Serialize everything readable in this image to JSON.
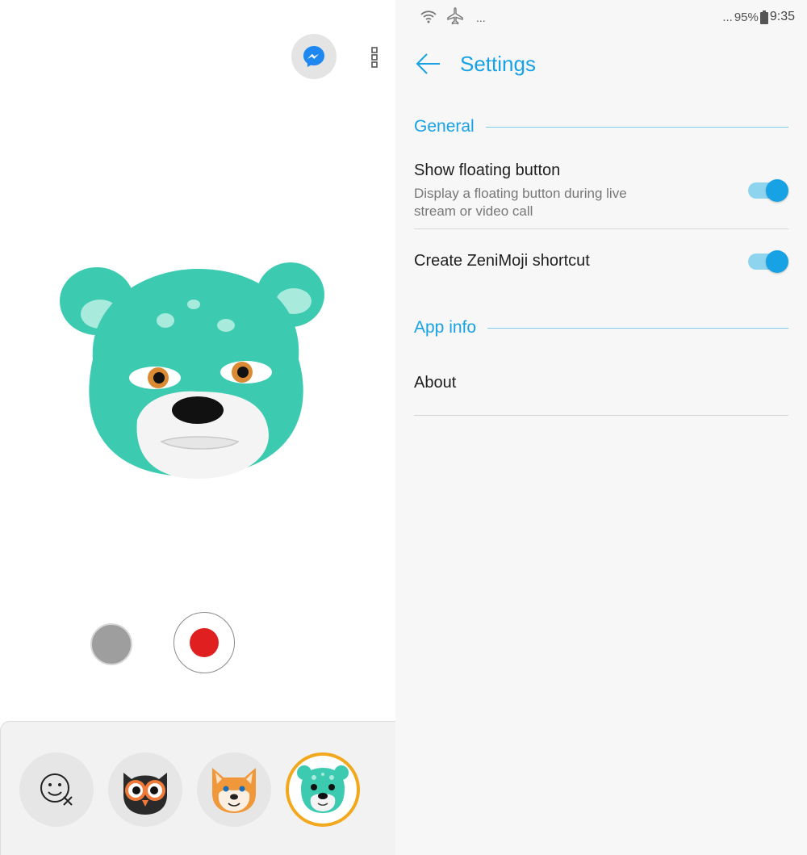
{
  "camera": {
    "messenger_icon": "messenger-icon",
    "more_icon": "more-vertical-icon",
    "tray": {
      "items": [
        {
          "name": "no-mask",
          "icon": "face-off-icon"
        },
        {
          "name": "owl",
          "icon": "owl-avatar"
        },
        {
          "name": "shiba",
          "icon": "shiba-avatar"
        },
        {
          "name": "bear",
          "icon": "bear-avatar",
          "selected": true
        }
      ]
    }
  },
  "status_bar": {
    "left_dots": "...",
    "right_dots": "...",
    "battery": "95%",
    "time": "9:35"
  },
  "settings": {
    "title": "Settings",
    "general": {
      "header": "General",
      "show_floating": {
        "title": "Show floating button",
        "subtitle": "Display a floating button during live stream or video call",
        "enabled": true
      },
      "shortcut": {
        "title": "Create ZeniMoji shortcut",
        "enabled": true
      }
    },
    "app_info": {
      "header": "App info",
      "about": "About"
    }
  },
  "colors": {
    "accent": "#17a2e6",
    "record": "#e02020",
    "selected_ring": "#f2a81d",
    "bear": "#3ccbb0"
  }
}
